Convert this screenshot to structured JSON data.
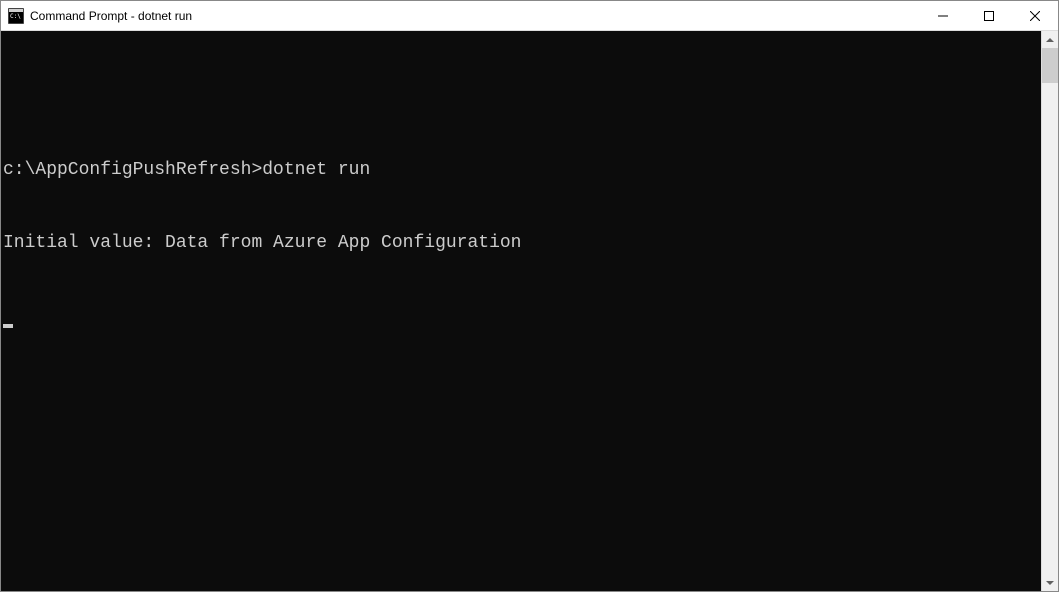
{
  "window": {
    "title": "Command Prompt - dotnet  run"
  },
  "terminal": {
    "prompt_path": "c:\\AppConfigPushRefresh>",
    "command": "dotnet run",
    "output_line1": "Initial value: Data from Azure App Configuration"
  }
}
